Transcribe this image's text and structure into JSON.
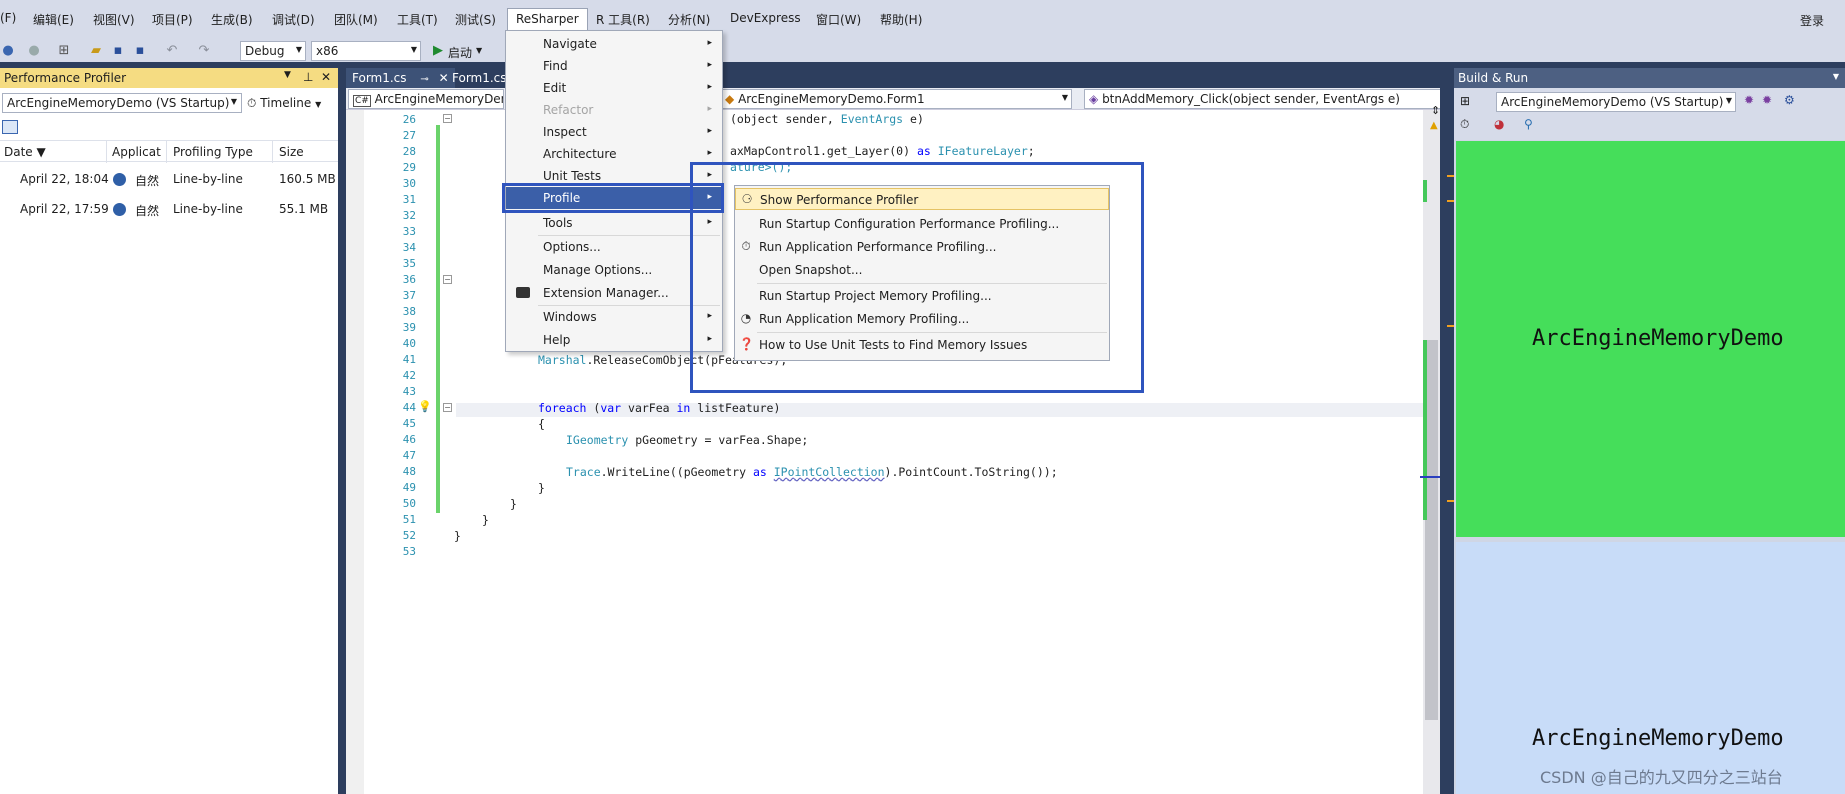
{
  "menubar": {
    "items": [
      "(F)",
      "编辑(E)",
      "视图(V)",
      "项目(P)",
      "生成(B)",
      "调试(D)",
      "团队(M)",
      "工具(T)",
      "测试(S)",
      "ReSharper",
      "R 工具(R)",
      "分析(N)",
      "DevExpress",
      "窗口(W)",
      "帮助(H)"
    ],
    "login": "登录"
  },
  "toolbar": {
    "config": "Debug",
    "platform": "x86",
    "start": "启动"
  },
  "perf_panel": {
    "title": "Performance Profiler",
    "project_combo": "ArcEngineMemoryDemo (VS Startup)",
    "timeline": "Timeline",
    "columns": [
      "Date",
      "Applicat",
      "Profiling Type",
      "Size"
    ],
    "rows": [
      {
        "date": "April 22, 18:04",
        "app": "自然",
        "type": "Line-by-line",
        "size": "160.5 MB"
      },
      {
        "date": "April 22, 17:59",
        "app": "自然",
        "type": "Line-by-line",
        "size": "55.1 MB"
      }
    ]
  },
  "editor": {
    "tabs": [
      "Form1.cs",
      "Form1.cs"
    ],
    "nav_left": "ArcEngineMemoryDemo",
    "nav_mid": "ArcEngineMemoryDemo.Form1",
    "nav_right": "btnAddMemory_Click(object sender, EventArgs e)",
    "line_numbers": [
      "26",
      "27",
      "28",
      "29",
      "30",
      "31",
      "32",
      "33",
      "34",
      "35",
      "36",
      "37",
      "38",
      "39",
      "40",
      "41",
      "42",
      "43",
      "44",
      "45",
      "46",
      "47",
      "48",
      "49",
      "50",
      "51",
      "52",
      "53"
    ],
    "code": {
      "l26a": "(object sender, ",
      "l26b": "EventArgs",
      "l26c": " e)",
      "l28a": "axMapControl1.get_Layer(0) ",
      "l28b": "as",
      "l28c": " ",
      "l28d": "IFeatureLayer",
      "l28e": ";",
      "l29": "ature>();",
      "l41a": "Marshal",
      "l41b": ".ReleaseComObject(pFeatures);",
      "l44a": "foreach",
      "l44b": " (",
      "l44c": "var",
      "l44d": " varFea ",
      "l44e": "in",
      "l44f": " listFeature)",
      "l45": "{",
      "l46a": "IGeometry",
      "l46b": " pGeometry = varFea.Shape;",
      "l48a": "Trace",
      "l48b": ".WriteLine((pGeometry ",
      "l48c": "as",
      "l48d": " ",
      "l48e": "IPointCollection",
      "l48f": ").PointCount.ToString());",
      "l49": "}",
      "l50": "}",
      "l51": "}",
      "l52": "}"
    }
  },
  "resharper_menu": {
    "items": [
      {
        "label": "Navigate",
        "sub": true,
        "disabled": false
      },
      {
        "label": "Find",
        "sub": true,
        "disabled": false
      },
      {
        "label": "Edit",
        "sub": true,
        "disabled": false
      },
      {
        "label": "Refactor",
        "sub": true,
        "disabled": true
      },
      {
        "label": "Inspect",
        "sub": true,
        "disabled": false
      },
      {
        "label": "Architecture",
        "sub": true,
        "disabled": false
      },
      {
        "label": "Unit Tests",
        "sub": true,
        "disabled": false
      },
      {
        "label": "Profile",
        "sub": true,
        "disabled": false
      },
      {
        "label": "Tools",
        "sub": true,
        "disabled": false
      },
      {
        "label": "Options...",
        "sub": false,
        "disabled": false
      },
      {
        "label": "Manage Options...",
        "sub": false,
        "disabled": false
      },
      {
        "label": "Extension Manager...",
        "sub": false,
        "disabled": false
      },
      {
        "label": "Windows",
        "sub": true,
        "disabled": false
      },
      {
        "label": "Help",
        "sub": true,
        "disabled": false
      }
    ],
    "arrow": "▸"
  },
  "profile_submenu": {
    "items": [
      {
        "label": "Show Performance Profiler",
        "icon": "profiler-icon"
      },
      {
        "label": "Run Startup Configuration Performance Profiling...",
        "icon": ""
      },
      {
        "label": "Run Application Performance Profiling...",
        "icon": "stopwatch-icon"
      },
      {
        "label": "Open Snapshot...",
        "icon": ""
      },
      {
        "label": "Run Startup Project Memory Profiling...",
        "icon": ""
      },
      {
        "label": "Run Application Memory Profiling...",
        "icon": "memory-icon"
      },
      {
        "label": "How to Use Unit Tests to Find Memory Issues",
        "icon": "help-icon"
      }
    ]
  },
  "build_run": {
    "title": "Build & Run",
    "project_combo": "ArcEngineMemoryDemo (VS Startup)",
    "tile1": "ArcEngineMemoryDemo",
    "tile2": "ArcEngineMemoryDemo",
    "colors": {
      "green": "#45de5a",
      "blue": "#c8dcf8"
    }
  },
  "watermark": "CSDN @自己的九又四分之三站台"
}
